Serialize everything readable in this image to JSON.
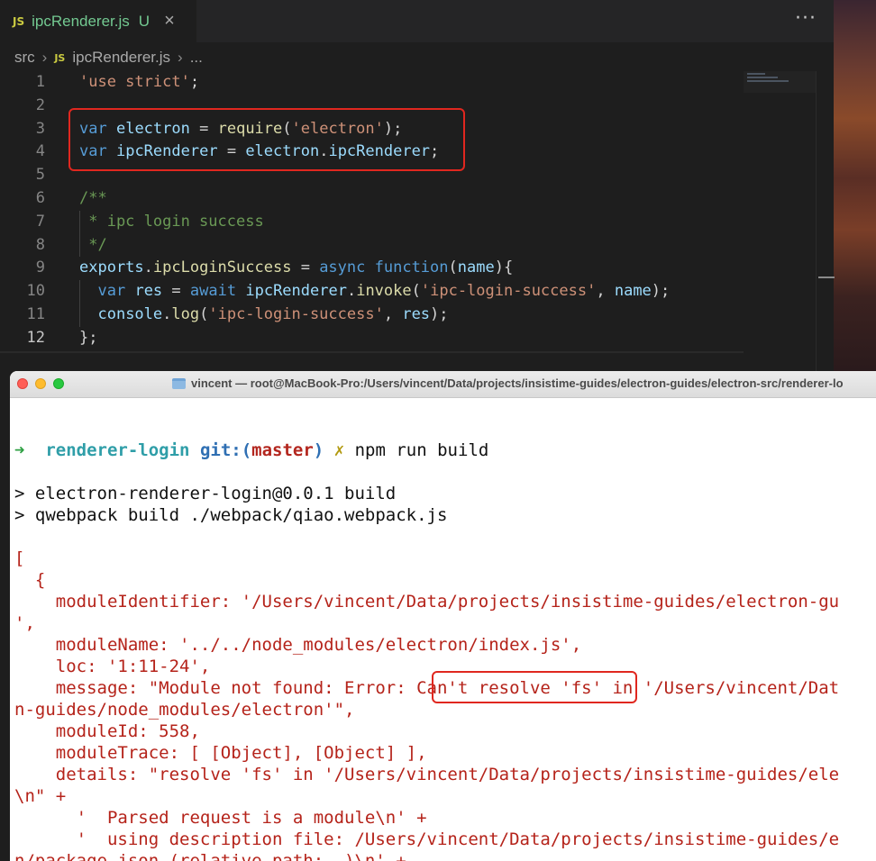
{
  "editor": {
    "tab": {
      "badge": "JS",
      "filename": "ipcRenderer.js",
      "status": "U",
      "close_glyph": "×"
    },
    "more_actions": "···",
    "breadcrumb": {
      "folder": "src",
      "badge": "JS",
      "file": "ipcRenderer.js",
      "ellipsis": "..."
    },
    "lines": [
      {
        "num": "1",
        "text": "'use strict';"
      },
      {
        "num": "2",
        "text": ""
      },
      {
        "num": "3",
        "text": "var electron = require('electron');"
      },
      {
        "num": "4",
        "text": "var ipcRenderer = electron.ipcRenderer;"
      },
      {
        "num": "5",
        "text": ""
      },
      {
        "num": "6",
        "text": "/**"
      },
      {
        "num": "7",
        "text": " * ipc login success"
      },
      {
        "num": "8",
        "text": " */"
      },
      {
        "num": "9",
        "text": "exports.ipcLoginSuccess = async function(name){"
      },
      {
        "num": "10",
        "text": "  var res = await ipcRenderer.invoke('ipc-login-success', name);"
      },
      {
        "num": "11",
        "text": "  console.log('ipc-login-success', res);"
      },
      {
        "num": "12",
        "text": "};"
      }
    ],
    "active_line": "12"
  },
  "terminal": {
    "title": "vincent — root@MacBook-Pro:/Users/vincent/Data/projects/insistime-guides/electron-guides/electron-src/renderer-lo",
    "prompt": {
      "arrow": "➜",
      "dir": "renderer-login",
      "git_label": "git:(",
      "branch": "master",
      "git_close": ")",
      "dirty": "✗",
      "command": "npm run build"
    },
    "output": [
      "> electron-renderer-login@0.0.1 build",
      "> qwebpack build ./webpack/qiao.webpack.js"
    ],
    "error": [
      "[",
      "  {",
      "    moduleIdentifier: '/Users/vincent/Data/projects/insistime-guides/electron-gu",
      "',",
      "    moduleName: '../../node_modules/electron/index.js',",
      "    loc: '1:11-24',",
      "    message: \"Module not found: Error: Can't resolve 'fs' in '/Users/vincent/Dat",
      "n-guides/node_modules/electron'\",",
      "    moduleId: 558,",
      "    moduleTrace: [ [Object], [Object] ],",
      "    details: \"resolve 'fs' in '/Users/vincent/Data/projects/insistime-guides/ele",
      "\\n\" +",
      "      '  Parsed request is a module\\n' +",
      "      '  using description file: /Users/vincent/Data/projects/insistime-guides/e",
      "n/package.json (relative path: .)\\n' +"
    ],
    "highlight": "Can't resolve 'fs'"
  }
}
